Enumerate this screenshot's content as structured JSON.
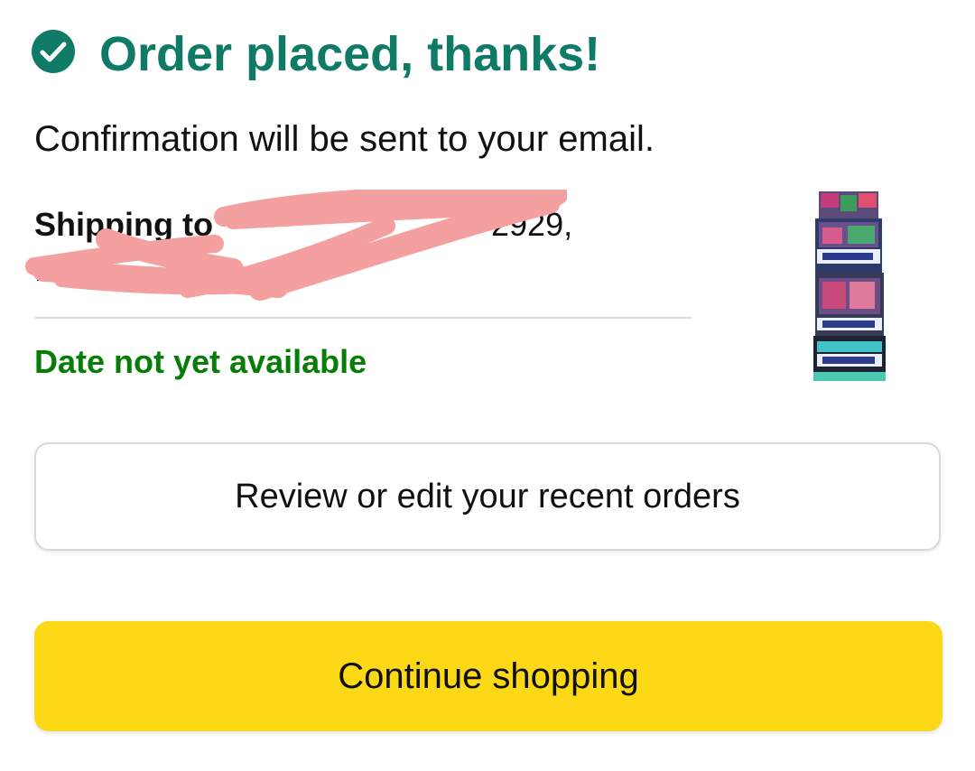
{
  "confirmation": {
    "title": "Order placed, thanks!",
    "subtitle": "Confirmation will be sent to your email.",
    "icon": "check-circle-icon",
    "accent_color": "#0f7a65"
  },
  "shipping": {
    "label": "Shipping to",
    "address_visible_fragment": "2929,"
  },
  "delivery": {
    "status": "Date not yet available",
    "color": "#067d06"
  },
  "product": {
    "image_icon": "product-box-image"
  },
  "actions": {
    "review_label": "Review or edit your recent orders",
    "continue_label": "Continue shopping",
    "continue_color": "#fcd817"
  }
}
